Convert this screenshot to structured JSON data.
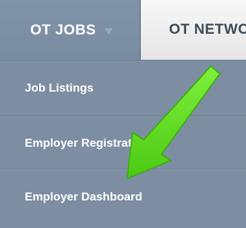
{
  "nav": {
    "active_tab": "OT JOBS",
    "inactive_tab": "OT NETWO"
  },
  "dropdown": {
    "items": [
      {
        "label": "Job Listings"
      },
      {
        "label": "Employer Registration"
      },
      {
        "label": "Employer Dashboard"
      }
    ]
  },
  "colors": {
    "menu_bg": "#7d8ea3",
    "annotation_arrow": "#5fe31a"
  },
  "icons": {
    "tab_dropdown": "chevron-down-icon",
    "annotation": "green-arrow-icon"
  }
}
